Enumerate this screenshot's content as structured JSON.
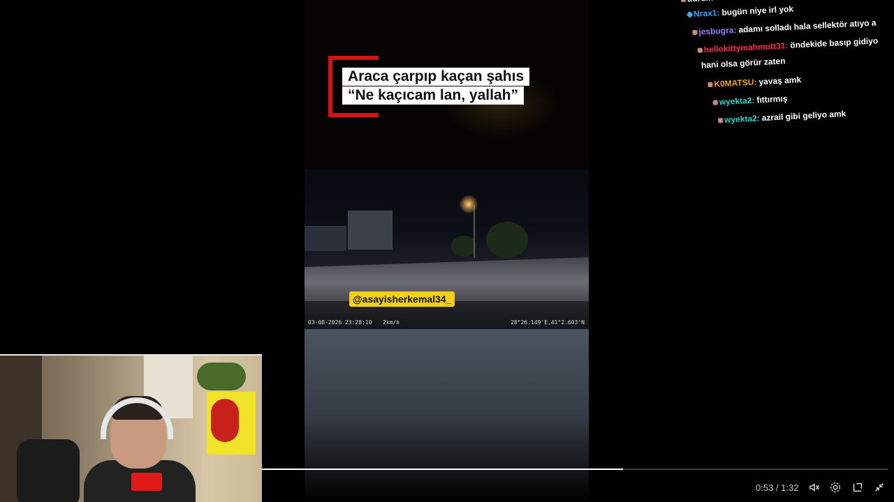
{
  "headline": {
    "line1": "Araca çarpıp kaçan şahıs",
    "line2": "“Ne kaçıcam lan, yallah”"
  },
  "dashcam": {
    "watermark": "@asayisherkemal34_",
    "date_time": "03-08-2026 23:28:10",
    "speed": "2km/h",
    "coordinates": "28°26.149'E,41°2.603'N"
  },
  "chat": {
    "messages": [
      {
        "user": "durum",
        "text": "",
        "color": "#ffffff"
      },
      {
        "user": "Nrax1:",
        "text": "bugün niye irl yok",
        "color": "#3aa0ff"
      },
      {
        "user": "jesbugra:",
        "text": "adamı solladı hala sellektör atıyo a",
        "color": "#9a7dff"
      },
      {
        "user": "hellokittymahmutt31:",
        "text": "öndekide basıp gidiyo",
        "color": "#ff2a4a"
      },
      {
        "user": "",
        "text": "hani olsa görür zaten",
        "color": "#ffffff"
      },
      {
        "user": "K0MATSU:",
        "text": "yavaş amk",
        "color": "#f0a020"
      },
      {
        "user": "wyekta2:",
        "text": "fıttırmış",
        "color": "#2ad4c8"
      },
      {
        "user": "wyekta2:",
        "text": "azrail gibi geliyo amk",
        "color": "#2ad4c8"
      }
    ]
  },
  "player": {
    "time": "0:53 / 1:32",
    "progress_fraction": 0.576,
    "icons": [
      "volume-icon",
      "settings-icon",
      "theater-mode-icon",
      "exit-fullscreen-icon"
    ]
  },
  "colors": {
    "headline_accent": "#d41414",
    "watermark_bg": "#f2d116"
  }
}
